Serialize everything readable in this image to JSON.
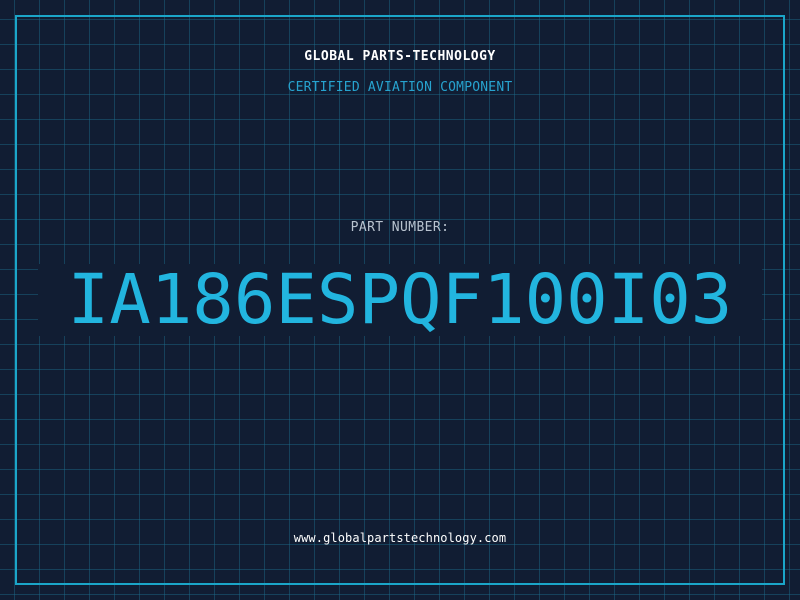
{
  "header": {
    "company": "GLOBAL PARTS-TECHNOLOGY",
    "subtitle": "CERTIFIED AVIATION COMPONENT"
  },
  "part": {
    "label": "PART NUMBER:",
    "number": "IA186ESPQF100I03"
  },
  "footer": {
    "website": "www.globalpartstechnology.com"
  },
  "colors": {
    "background": "#111d33",
    "grid": "#1d6d8c",
    "accent": "#1ba6c9",
    "part_number": "#22b5df",
    "text": "#ffffff"
  }
}
